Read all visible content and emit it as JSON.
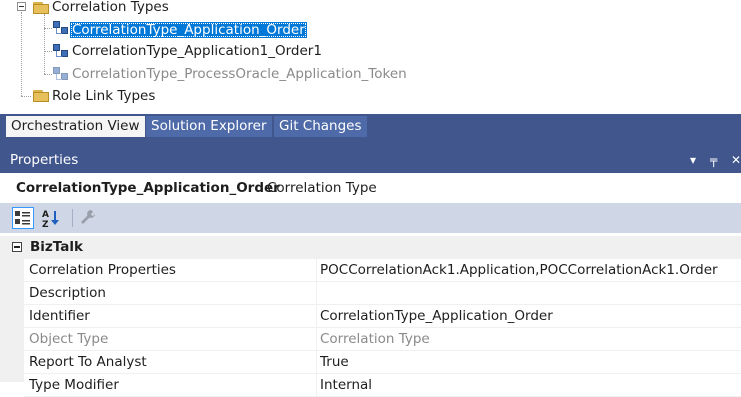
{
  "tree": {
    "root_folder": "Correlation Types",
    "items": [
      {
        "label": "CorrelationType_Application_Order",
        "state": "selected"
      },
      {
        "label": "CorrelationType_Application1_Order1",
        "state": "normal"
      },
      {
        "label": "CorrelationType_ProcessOracle_Application_Token",
        "state": "dimmed"
      }
    ],
    "second_folder": "Role Link Types"
  },
  "tabs": [
    {
      "label": "Orchestration View",
      "active": true
    },
    {
      "label": "Solution Explorer",
      "active": false
    },
    {
      "label": "Git Changes",
      "active": false
    }
  ],
  "properties": {
    "title": "Properties",
    "controls": {
      "dropdown": "▾",
      "pin": "╤",
      "close": "✕"
    },
    "object_name": "CorrelationType_Application_Order",
    "object_type": "Correlation Type",
    "toolbar": {
      "categorized_icon": "categorized-icon",
      "alphabetical_icon": "alphabetical-icon",
      "property_pages_icon": "wrench-icon"
    },
    "category": "BizTalk",
    "rows": [
      {
        "name": "Correlation Properties",
        "value": "POCCorrelationAck1.Application,POCCorrelationAck1.Order",
        "readonly": false
      },
      {
        "name": "Description",
        "value": "",
        "readonly": false
      },
      {
        "name": "Identifier",
        "value": "CorrelationType_Application_Order",
        "readonly": false
      },
      {
        "name": "Object Type",
        "value": "Correlation Type",
        "readonly": true
      },
      {
        "name": "Report To Analyst",
        "value": "True",
        "readonly": false
      },
      {
        "name": "Type Modifier",
        "value": "Internal",
        "readonly": false
      }
    ]
  },
  "colors": {
    "panel_blue": "#40568d",
    "selection_blue": "#0078d7",
    "toolbar_bg": "#cfd6e5"
  }
}
